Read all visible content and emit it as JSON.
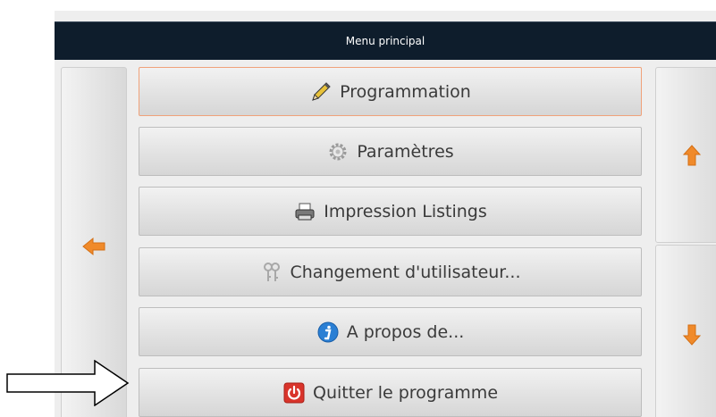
{
  "window": {
    "title": "Menu principal"
  },
  "menu": {
    "items": [
      {
        "label": "Programmation",
        "icon": "pencil-icon"
      },
      {
        "label": "Paramètres",
        "icon": "gear-icon"
      },
      {
        "label": "Impression Listings",
        "icon": "printer-icon"
      },
      {
        "label": "Changement d'utilisateur...",
        "icon": "keys-icon"
      },
      {
        "label": "A propos de...",
        "icon": "info-icon"
      },
      {
        "label": "Quitter le programme",
        "icon": "power-icon"
      }
    ]
  },
  "navigation": {
    "left_icon": "arrow-left-icon",
    "up_icon": "arrow-up-icon",
    "down_icon": "arrow-down-icon"
  },
  "colors": {
    "titlebar": "#0e1d2c",
    "accent_arrow": "#f08a2a",
    "active_border": "#f0a27a",
    "power_red": "#d9342b",
    "info_blue": "#2a7fd4"
  }
}
